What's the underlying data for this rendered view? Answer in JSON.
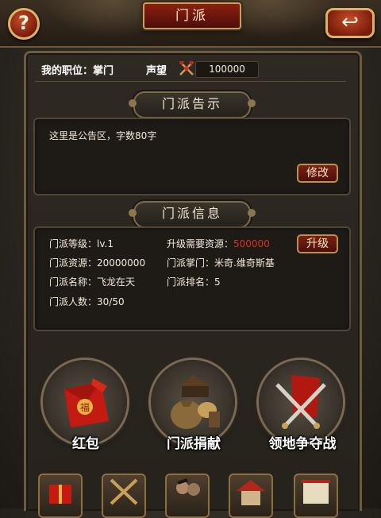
{
  "header": {
    "title": "门派",
    "help_symbol": "?",
    "back_symbol": "↩"
  },
  "status": {
    "job_label": "我的职位：掌门",
    "fame_label": "声望",
    "fame_value": "100000"
  },
  "notice": {
    "title": "门派告示",
    "text": "这里是公告区，字数80字",
    "edit_button": "修改"
  },
  "info": {
    "title": "门派信息",
    "upgrade_button": "升级",
    "level": "门派等级：lv.1",
    "resources": "门派资源：20000000",
    "name": "门派名称：飞龙在天",
    "members": "门派人数：30/50",
    "upgrade_cost_label": "升级需要资源：",
    "upgrade_cost_value": "500000",
    "leader": "门派掌门：米奇.维奇斯基",
    "rank": "门派排名：5"
  },
  "features": [
    {
      "label": "红包",
      "icon": "red-envelope-icon"
    },
    {
      "label": "门派捐献",
      "icon": "donation-bag-icon"
    },
    {
      "label": "领地争夺战",
      "icon": "crossed-swords-flag-icon"
    }
  ],
  "bottom_icons": [
    "gift-box-icon",
    "crossed-weapons-icon",
    "warriors-icon",
    "building-icon",
    "scroll-icon"
  ],
  "colors": {
    "accent_red": "#d8301e",
    "gold_border": "#c9a05a",
    "panel_bg": "#1e1b17"
  }
}
